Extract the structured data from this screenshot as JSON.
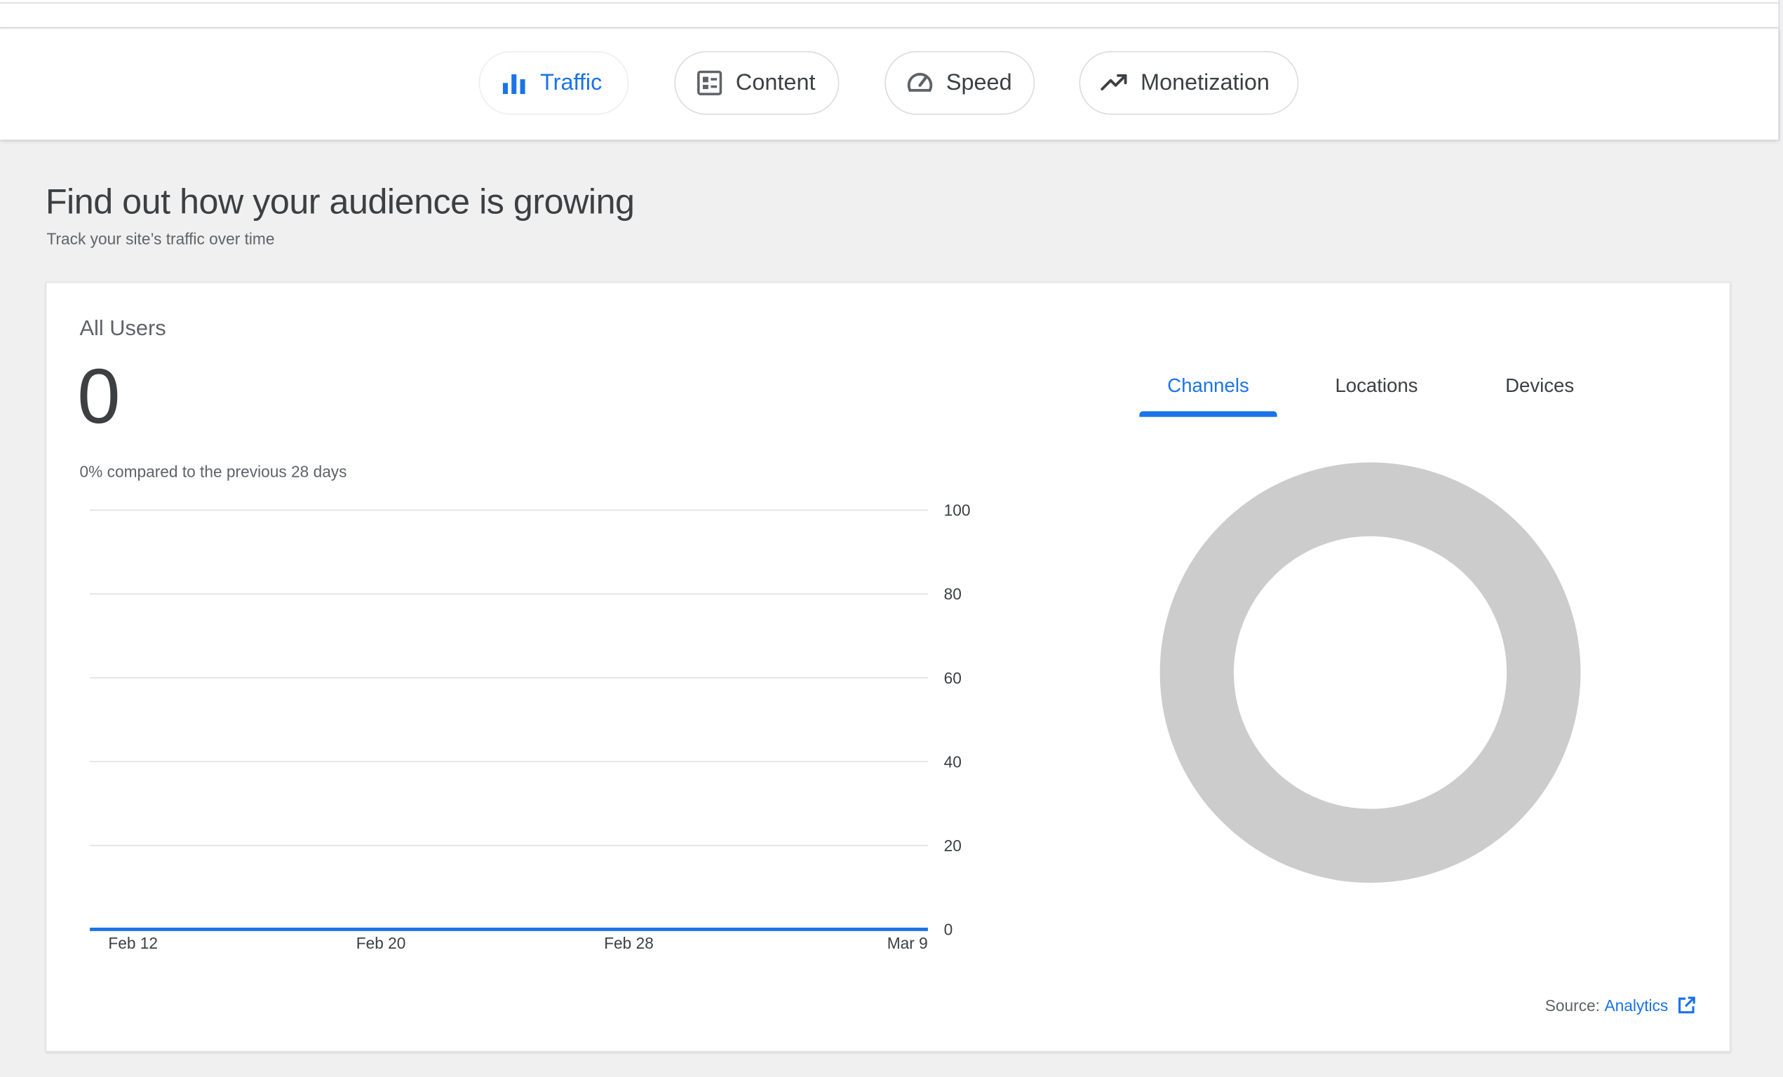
{
  "tabs": [
    {
      "label": "Traffic",
      "icon": "bar-chart-icon",
      "active": true
    },
    {
      "label": "Content",
      "icon": "content-icon",
      "active": false
    },
    {
      "label": "Speed",
      "icon": "speedometer-icon",
      "active": false
    },
    {
      "label": "Monetization",
      "icon": "trending-up-icon",
      "active": false
    }
  ],
  "section": {
    "title": "Find out how your audience is growing",
    "subtitle": "Track your site’s traffic over time"
  },
  "card": {
    "metric_label": "All Users",
    "metric_value": "0",
    "compare_text": "0% compared to the previous 28 days",
    "segment_tabs": [
      {
        "label": "Channels",
        "active": true
      },
      {
        "label": "Locations",
        "active": false
      },
      {
        "label": "Devices",
        "active": false
      }
    ],
    "source_label": "Source:",
    "source_link": "Analytics"
  },
  "colors": {
    "accent": "#1a73e8",
    "donut_empty": "#cccccc",
    "gridline": "#e0e0e0",
    "text": "#3c4043"
  },
  "chart_data": [
    {
      "type": "line",
      "x": [
        "Feb 12",
        "Feb 20",
        "Feb 28",
        "Mar 9"
      ],
      "series": [
        {
          "values": [
            0,
            0,
            0,
            0
          ]
        }
      ],
      "ylim": [
        0,
        100
      ],
      "yticks": [
        0,
        20,
        40,
        60,
        80,
        100
      ],
      "grid": true,
      "yaxis_position": "right"
    },
    {
      "type": "pie",
      "values": [],
      "donut": true,
      "empty": true
    }
  ]
}
